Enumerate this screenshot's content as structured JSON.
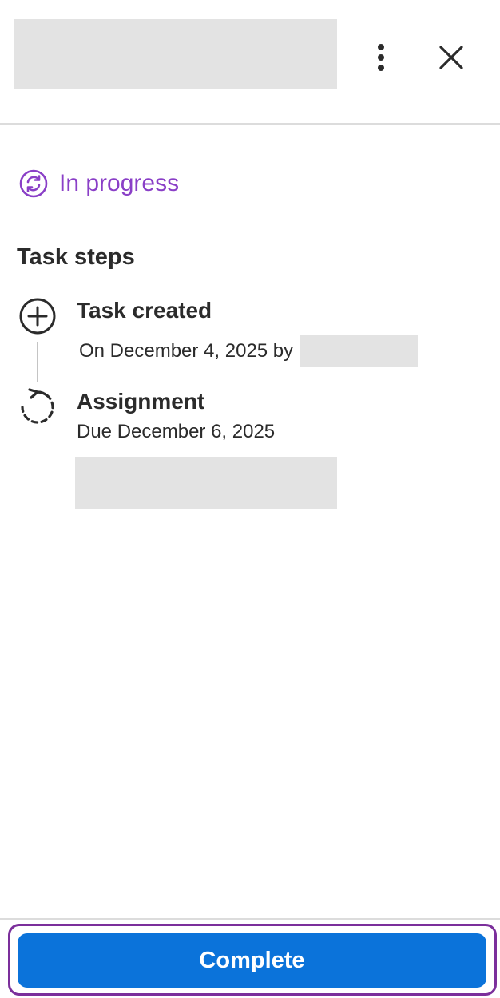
{
  "header": {
    "title": "",
    "more_icon": "more-vertical-icon",
    "close_icon": "close-icon"
  },
  "status": {
    "label": "In progress",
    "icon": "in-progress-icon",
    "color": "#8a3fc7"
  },
  "steps": {
    "section_title": "Task steps",
    "items": [
      {
        "title": "Task created",
        "subtitle": "On December 4, 2025 by",
        "icon": "plus-circle-icon"
      },
      {
        "title": "Assignment",
        "subtitle": "Due December 6, 2025",
        "icon": "dashed-circle-arrow-icon"
      }
    ]
  },
  "footer": {
    "complete_label": "Complete",
    "button_color": "#0b73da",
    "focus_color": "#7b2f9b"
  }
}
